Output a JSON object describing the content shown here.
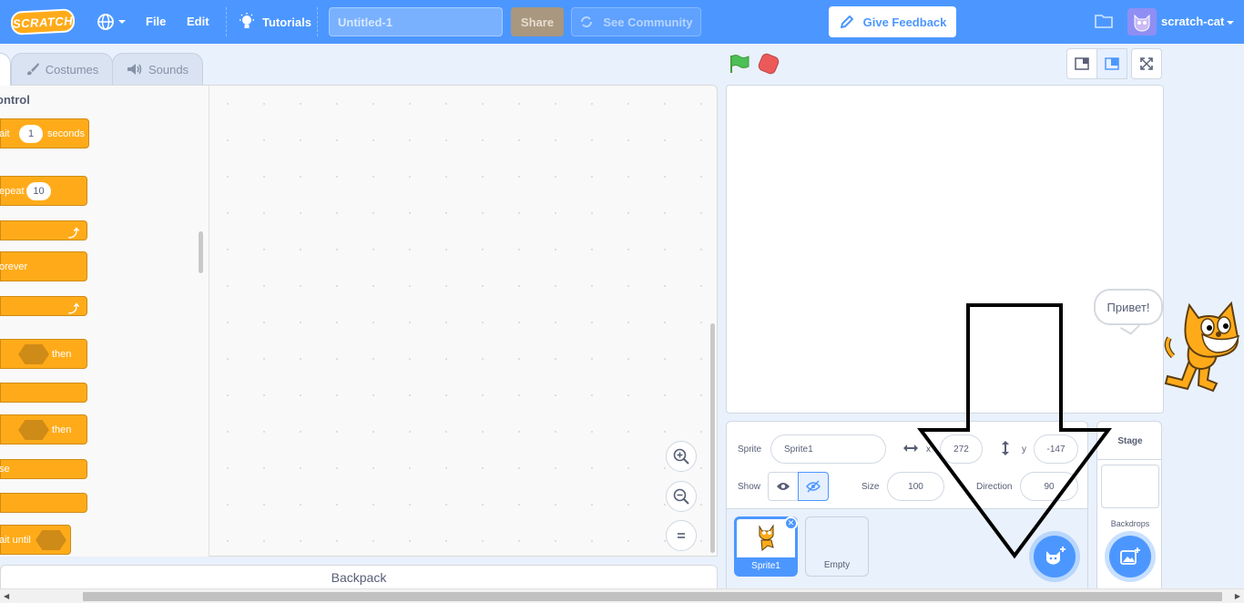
{
  "menubar": {
    "logo": "SCRATCH",
    "file": "File",
    "edit": "Edit",
    "tutorials": "Tutorials",
    "project_title_placeholder": "Untitled-1",
    "share": "Share",
    "see_community": "See Community",
    "give_feedback": "Give Feedback",
    "username": "scratch-cat"
  },
  "tabs": {
    "costumes": "Costumes",
    "sounds": "Sounds"
  },
  "palette": {
    "category_title": "ontrol",
    "wait_prefix": "ait",
    "wait_value": "1",
    "wait_suffix": "seconds",
    "repeat_prefix": "epeat",
    "repeat_value": "10",
    "forever": "orever",
    "if_then": "then",
    "if_else_then": "then",
    "else": "se",
    "wait_until": "ait until"
  },
  "backpack": "Backpack",
  "stage": {
    "speech_bubble": "Привет!"
  },
  "sprite_info": {
    "sprite_label": "Sprite",
    "sprite_name": "Sprite1",
    "x_label": "x",
    "x_value": "272",
    "y_label": "y",
    "y_value": "-147",
    "show_label": "Show",
    "size_label": "Size",
    "size_value": "100",
    "direction_label": "Direction",
    "direction_value": "90"
  },
  "sprites": [
    {
      "name": "Sprite1"
    },
    {
      "name": "Empty"
    }
  ],
  "stage_pane": {
    "title": "Stage",
    "backdrops": "Backdrops"
  },
  "colors": {
    "menubar": "#4c97ff",
    "control_block": "#ffab19",
    "accent": "#4c97ff"
  }
}
